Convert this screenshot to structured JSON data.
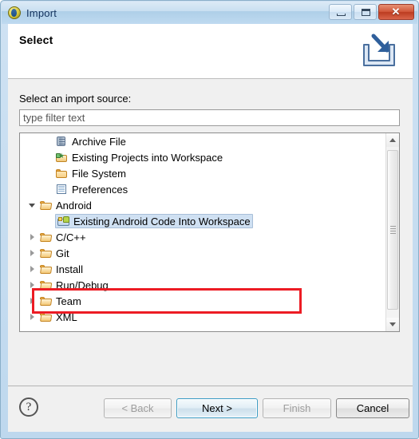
{
  "window": {
    "title": "Import",
    "app_icon": "eclipse-wizard-icon",
    "controls": {
      "minimize": "minimize-icon",
      "maximize": "maximize-icon",
      "close": "close-icon",
      "close_glyph": "✕"
    }
  },
  "header": {
    "title": "Select",
    "banner_icon": "import-arrow-icon"
  },
  "body": {
    "source_label": "Select an import source:",
    "filter": {
      "value": "",
      "placeholder": "type filter text"
    }
  },
  "tree": {
    "items": [
      {
        "label": "Archive File",
        "icon": "archive-file-icon",
        "indent": 1,
        "expander": "none",
        "selected": false
      },
      {
        "label": "Existing Projects into Workspace",
        "icon": "existing-projects-icon",
        "indent": 1,
        "expander": "none",
        "selected": false
      },
      {
        "label": "File System",
        "icon": "folder-icon",
        "indent": 1,
        "expander": "none",
        "selected": false
      },
      {
        "label": "Preferences",
        "icon": "preferences-icon",
        "indent": 1,
        "expander": "none",
        "selected": false
      },
      {
        "label": "Android",
        "icon": "folder-open-icon",
        "indent": 0,
        "expander": "expanded",
        "selected": false
      },
      {
        "label": "Existing Android Code Into Workspace",
        "icon": "android-project-icon",
        "indent": 1,
        "expander": "none",
        "selected": true
      },
      {
        "label": "C/C++",
        "icon": "folder-open-icon",
        "indent": 0,
        "expander": "collapsed",
        "selected": false
      },
      {
        "label": "Git",
        "icon": "folder-open-icon",
        "indent": 0,
        "expander": "collapsed",
        "selected": false
      },
      {
        "label": "Install",
        "icon": "folder-open-icon",
        "indent": 0,
        "expander": "collapsed",
        "selected": false
      },
      {
        "label": "Run/Debug",
        "icon": "folder-open-icon",
        "indent": 0,
        "expander": "collapsed",
        "selected": false
      },
      {
        "label": "Team",
        "icon": "folder-open-icon",
        "indent": 0,
        "expander": "collapsed",
        "selected": false
      },
      {
        "label": "XML",
        "icon": "folder-open-icon",
        "indent": 0,
        "expander": "collapsed",
        "selected": false
      }
    ],
    "scrollbar": {
      "up_arrow": "scroll-up-icon",
      "down_arrow": "scroll-down-icon"
    }
  },
  "annotation": {
    "highlight_color": "#ec1c24",
    "target": "Existing Android Code Into Workspace"
  },
  "footer": {
    "help": "?",
    "buttons": [
      {
        "id": "back",
        "label": "< Back",
        "state": "disabled"
      },
      {
        "id": "next",
        "label": "Next >",
        "state": "default"
      },
      {
        "id": "finish",
        "label": "Finish",
        "state": "disabled"
      },
      {
        "id": "cancel",
        "label": "Cancel",
        "state": "enabled"
      }
    ]
  },
  "colors": {
    "titlebar": "#bed8ee",
    "selection": "#cfe0f2",
    "accent": "#3c9cc4",
    "annotation": "#ec1c24"
  }
}
